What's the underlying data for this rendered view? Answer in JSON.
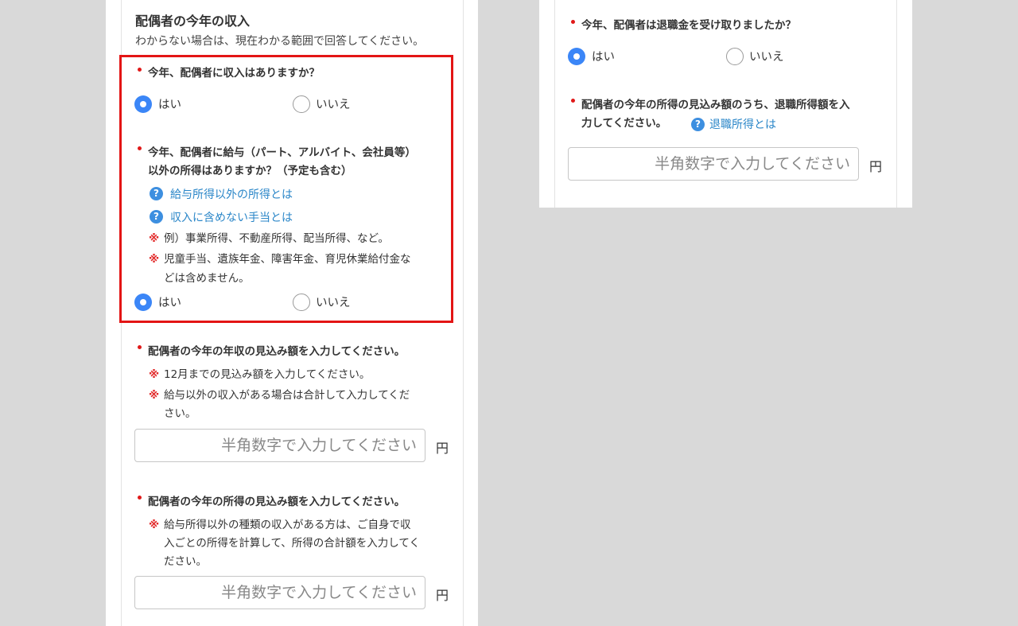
{
  "left": {
    "title": "配偶者の今年の収入",
    "subtitle": "わからない場合は、現在わかる範囲で回答してください。",
    "q1": {
      "text": "今年、配偶者に収入はありますか？",
      "yes": "はい",
      "no": "いいえ",
      "selected": "はい"
    },
    "q2": {
      "line1": "今年、配偶者に給与（パート、アルバイト、会社員等）",
      "line2": "以外の所得はありますか？（予定も含む）",
      "links": [
        "給与所得以外の所得とは",
        "収入に含めない手当とは"
      ],
      "notes": [
        "例）事業所得、不動産所得、配当所得、など。",
        "児童手当、遺族年金、障害年金、育児休業給付金な",
        "どは含めません。"
      ],
      "yes": "はい",
      "no": "いいえ",
      "selected": "はい"
    },
    "q3": {
      "text": "配偶者の今年の年収の見込み額を入力してください。",
      "notes": [
        "12月までの見込み額を入力してください。",
        "給与以外の収入がある場合は合計して入力してくだ",
        "さい。"
      ],
      "placeholder": "半角数字で入力してください",
      "unit": "円"
    },
    "q4": {
      "text": "配偶者の今年の所得の見込み額を入力してください。",
      "notes": [
        "給与所得以外の種類の収入がある方は、ご自身で収",
        "入ごとの所得を計算して、所得の合計額を入力してく",
        "ださい。"
      ],
      "placeholder": "半角数字で入力してください",
      "unit": "円"
    },
    "kome_mark": "※",
    "help_mark": "?"
  },
  "right": {
    "q1": {
      "text": "今年、配偶者は退職金を受け取りましたか？",
      "yes": "はい",
      "no": "いいえ",
      "selected": "はい"
    },
    "q2": {
      "line1": "配偶者の今年の所得の見込み額のうち、退職所得額を入",
      "line2": "力してください。",
      "link": "退職所得とは",
      "placeholder": "半角数字で入力してください",
      "unit": "円"
    }
  },
  "colors": {
    "background": "#d9d9d9",
    "required_dot": "#e01919",
    "radio_selected": "#3b86f7",
    "link": "#2a86c8",
    "highlight_border": "#e31515"
  }
}
